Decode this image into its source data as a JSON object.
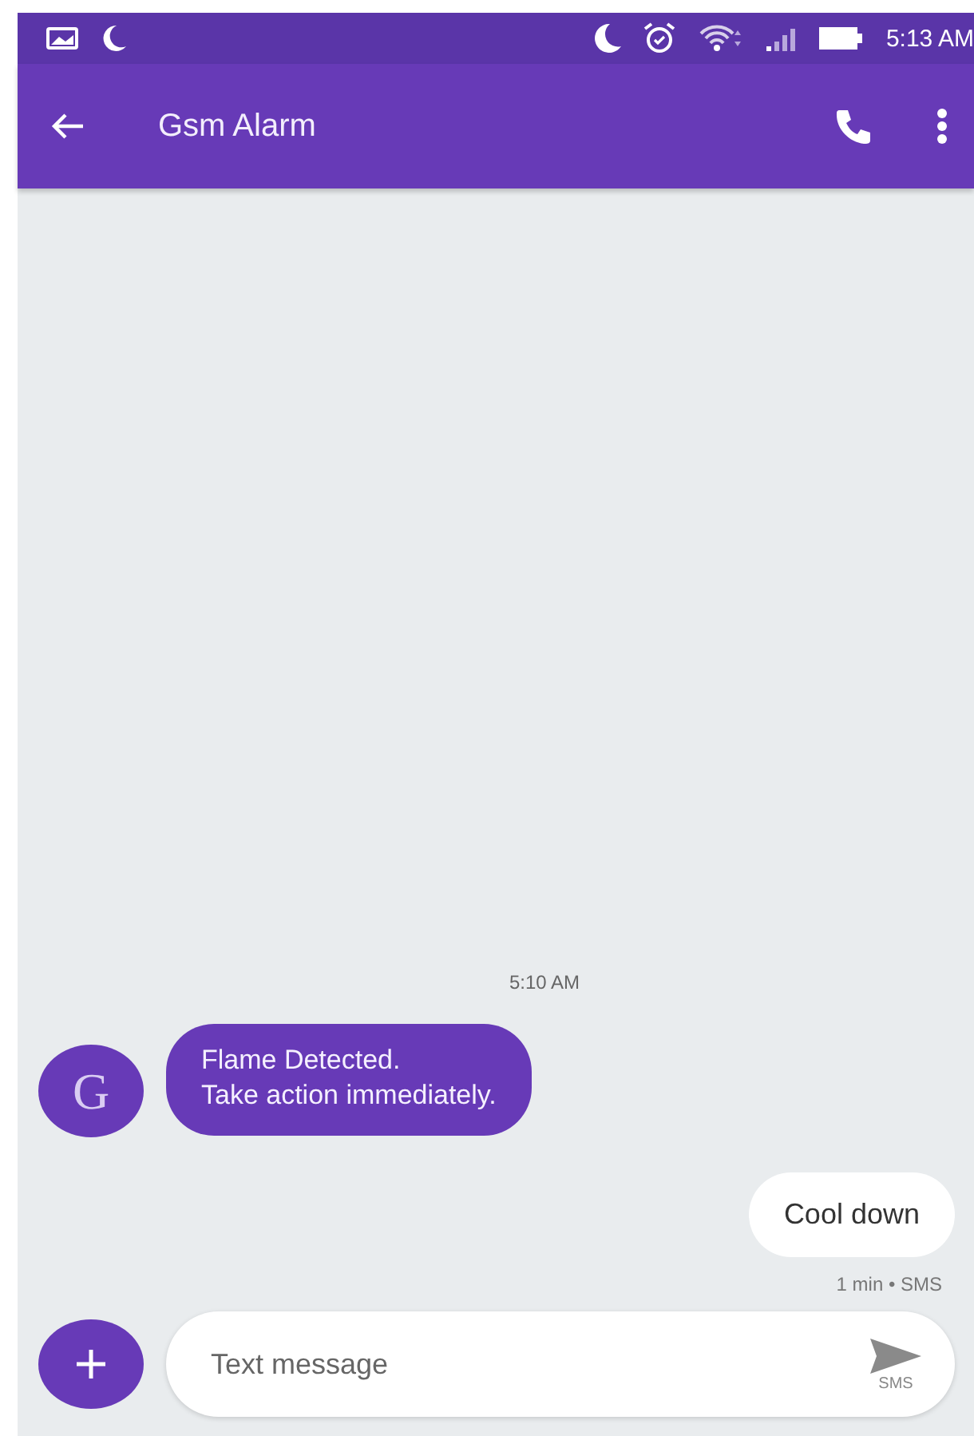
{
  "status_bar": {
    "time": "5:13 AM"
  },
  "app_bar": {
    "title": "Gsm Alarm"
  },
  "conversation": {
    "timestamp": "5:10 AM",
    "messages": [
      {
        "kind": "incoming",
        "avatar": "G",
        "lines": [
          "Flame Detected.",
          "Take action immediately."
        ]
      },
      {
        "kind": "outgoing",
        "lines": [
          "Cool down"
        ],
        "meta": "1 min • SMS"
      }
    ]
  },
  "composer": {
    "placeholder": "Text message",
    "send_label": "SMS"
  }
}
